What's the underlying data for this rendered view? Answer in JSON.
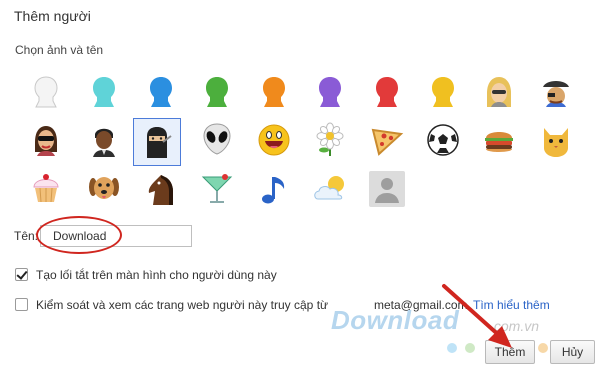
{
  "dialog": {
    "title": "Thêm người",
    "subtitle": "Chọn ảnh và tên"
  },
  "avatars": [
    {
      "icon": "white-head-icon",
      "color": "#f2f2f2"
    },
    {
      "icon": "cyan-head-icon",
      "color": "#5fd3d8"
    },
    {
      "icon": "blue-head-icon",
      "color": "#2b8fe0"
    },
    {
      "icon": "green-head-icon",
      "color": "#4caf3d"
    },
    {
      "icon": "orange-head-icon",
      "color": "#f08a1c"
    },
    {
      "icon": "purple-head-icon",
      "color": "#8a5bd6"
    },
    {
      "icon": "red-head-icon",
      "color": "#e23a3a"
    },
    {
      "icon": "yellow-head-icon",
      "color": "#f0c020"
    },
    {
      "icon": "blonde-woman-icon"
    },
    {
      "icon": "pirate-man-icon"
    },
    {
      "icon": "sunglasses-woman-icon"
    },
    {
      "icon": "man-icon"
    },
    {
      "icon": "ninja-icon"
    },
    {
      "icon": "alien-icon"
    },
    {
      "icon": "smiley-icon"
    },
    {
      "icon": "flower-icon"
    },
    {
      "icon": "pizza-icon"
    },
    {
      "icon": "soccer-ball-icon"
    },
    {
      "icon": "burger-icon"
    },
    {
      "icon": "cat-icon"
    },
    {
      "icon": "cupcake-icon"
    },
    {
      "icon": "dog-icon"
    },
    {
      "icon": "horse-icon"
    },
    {
      "icon": "cocktail-icon"
    },
    {
      "icon": "music-note-icon"
    },
    {
      "icon": "cloud-sun-icon"
    },
    {
      "icon": "default-avatar-icon"
    }
  ],
  "name": {
    "label": "Tên:",
    "value": "Download"
  },
  "options": {
    "shortcut_label": "Tạo lối tắt trên màn hình cho người dùng này",
    "shortcut_checked": true,
    "supervise_label": "Kiểm soát và xem các trang web người này truy cập từ",
    "supervise_checked": false,
    "account": "meta@gmail.com",
    "learn_more": "Tìm hiểu thêm"
  },
  "watermark": {
    "brand": "Download",
    "tld": ".com.vn"
  },
  "buttons": {
    "add": "Thêm",
    "cancel": "Hủy"
  },
  "colors": {
    "selection": "#4c7bd9",
    "annotation": "#d0261f",
    "link": "#2a63c7"
  }
}
